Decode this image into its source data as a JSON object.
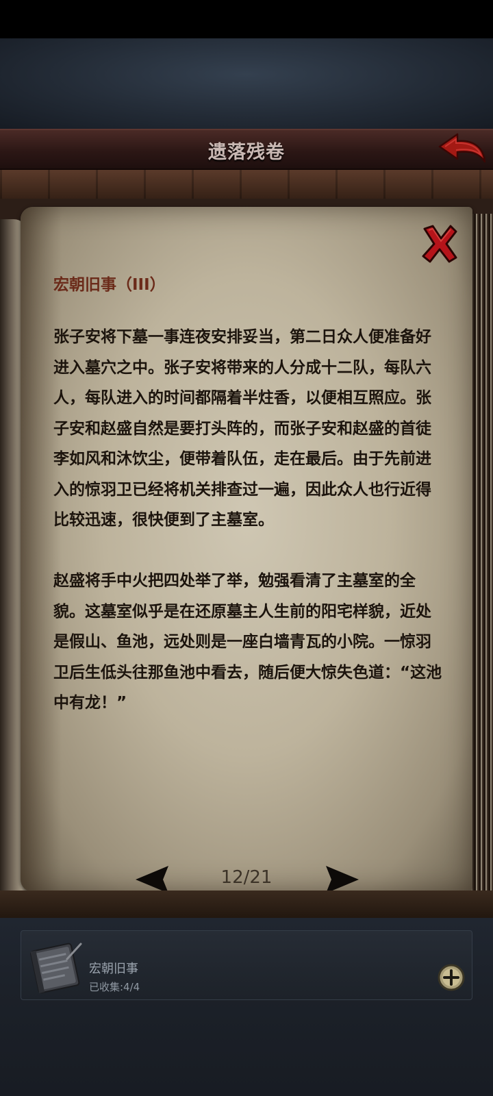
{
  "header": {
    "title": "遗落残卷"
  },
  "page": {
    "chapter_title": "宏朝旧事（III）",
    "story_text": "张子安将下墓一事连夜安排妥当，第二日众人便准备好进入墓穴之中。张子安将带来的人分成十二队，每队六人，每队进入的时间都隔着半炷香，以便相互照应。张子安和赵盛自然是要打头阵的，而张子安和赵盛的首徒李如风和沐饮尘，便带着队伍，走在最后。由于先前进入的惊羽卫已经将机关排查过一遍，因此众人也行近得比较迅速，很快便到了主墓室。\n\n赵盛将手中火把四处举了举，勉强看清了主墓室的全貌。这墓室似乎是在还原墓主人生前的阳宅样貌，近处是假山、鱼池，远处则是一座白墙青瓦的小院。一惊羽卫后生低头往那鱼池中看去，随后便大惊失色道：“这池中有龙！”",
    "page_indicator": "12/21"
  },
  "collection": {
    "name": "宏朝旧事",
    "count_label": "已收集:4/4"
  },
  "colors": {
    "title_bar": "#2c1715",
    "paper": "#bdb39c",
    "chapter_title": "#6b2b1a",
    "close_red": "#b5141a",
    "back_arrow_red": "#a31a14",
    "body_text": "#1c140d"
  },
  "icons": {
    "back": "back-arrow-icon",
    "close": "close-x-icon",
    "prev": "triangle-left-icon",
    "next": "triangle-right-icon",
    "collection": "book-icon",
    "add": "plus-circle-icon"
  }
}
